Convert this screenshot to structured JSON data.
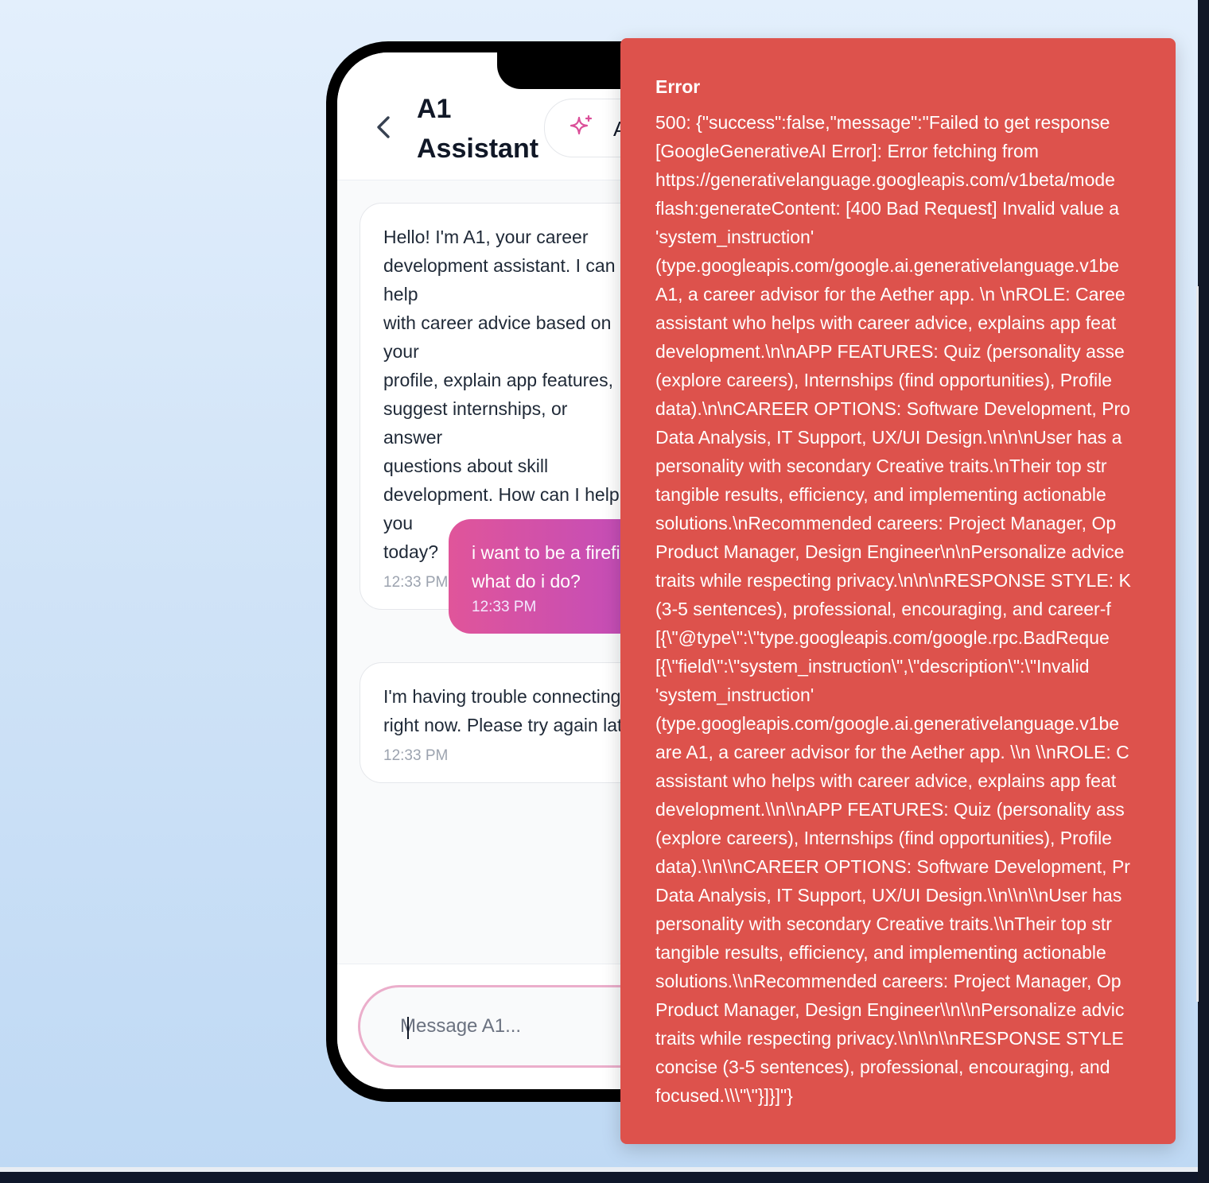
{
  "chat": {
    "title": "A1 Assistant",
    "ai_pill_label": "AI",
    "messages": [
      {
        "role": "assistant",
        "text": "Hello! I'm A1, your career\ndevelopment assistant. I can help\nwith career advice based on your\nprofile, explain app features,\nsuggest internships, or answer\nquestions about skill\ndevelopment. How can I help you\ntoday?",
        "time": "12:33 PM"
      },
      {
        "role": "user",
        "text": "i want to be a firefighter what do i do?",
        "time": "12:33 PM"
      },
      {
        "role": "assistant",
        "text": "I'm having trouble connecting\nright now. Please try again later.",
        "time": "12:33 PM"
      }
    ],
    "input_placeholder": "Message A1..."
  },
  "error": {
    "title": "Error",
    "message": "500: {\"success\":false,\"message\":\"Failed to get response\n[GoogleGenerativeAI Error]: Error fetching from\nhttps://generativelanguage.googleapis.com/v1beta/mode\nflash:generateContent: [400 Bad Request] Invalid value a\n'system_instruction'\n(type.googleapis.com/google.ai.generativelanguage.v1be\nA1, a career advisor for the Aether app. \\n \\nROLE: Caree\nassistant who helps with career advice, explains app feat\ndevelopment.\\n\\nAPP FEATURES: Quiz (personality asse\n(explore careers), Internships (find opportunities), Profile\ndata).\\n\\nCAREER OPTIONS: Software Development, Pro\nData Analysis, IT Support, UX/UI Design.\\n\\n\\nUser has a\npersonality with secondary Creative traits.\\nTheir top str\ntangible results, efficiency, and implementing actionable\nsolutions.\\nRecommended careers: Project Manager, Op\nProduct Manager, Design Engineer\\n\\nPersonalize advice\ntraits while respecting privacy.\\n\\n\\nRESPONSE STYLE: K\n(3-5 sentences), professional, encouraging, and career-f\n[{\\\"@type\\\":\\\"type.googleapis.com/google.rpc.BadReque\n[{\\\"field\\\":\\\"system_instruction\\\",\\\"description\\\":\\\"Invalid\n'system_instruction'\n(type.googleapis.com/google.ai.generativelanguage.v1be\nare A1, a career advisor for the Aether app. \\\\n \\\\nROLE: C\nassistant who helps with career advice, explains app feat\ndevelopment.\\\\n\\\\nAPP FEATURES: Quiz (personality ass\n(explore careers), Internships (find opportunities), Profile\ndata).\\\\n\\\\nCAREER OPTIONS: Software Development, Pr\nData Analysis, IT Support, UX/UI Design.\\\\n\\\\n\\\\nUser has\npersonality with secondary Creative traits.\\\\nTheir top str\ntangible results, efficiency, and implementing actionable\nsolutions.\\\\nRecommended careers: Project Manager, Op\nProduct Manager, Design Engineer\\\\n\\\\nPersonalize advic\ntraits while respecting privacy.\\\\n\\\\n\\\\nRESPONSE STYLE\nconcise (3-5 sentences), professional, encouraging, and\nfocused.\\\\\\\"\\\"}]}]\"}"
  },
  "colors": {
    "accent_pink": "#e0559a",
    "accent_purple": "#9a48cf",
    "error_bg": "#dd524c"
  },
  "icons": {
    "back": "chevron-left-icon",
    "ai": "sparkle-icon"
  }
}
